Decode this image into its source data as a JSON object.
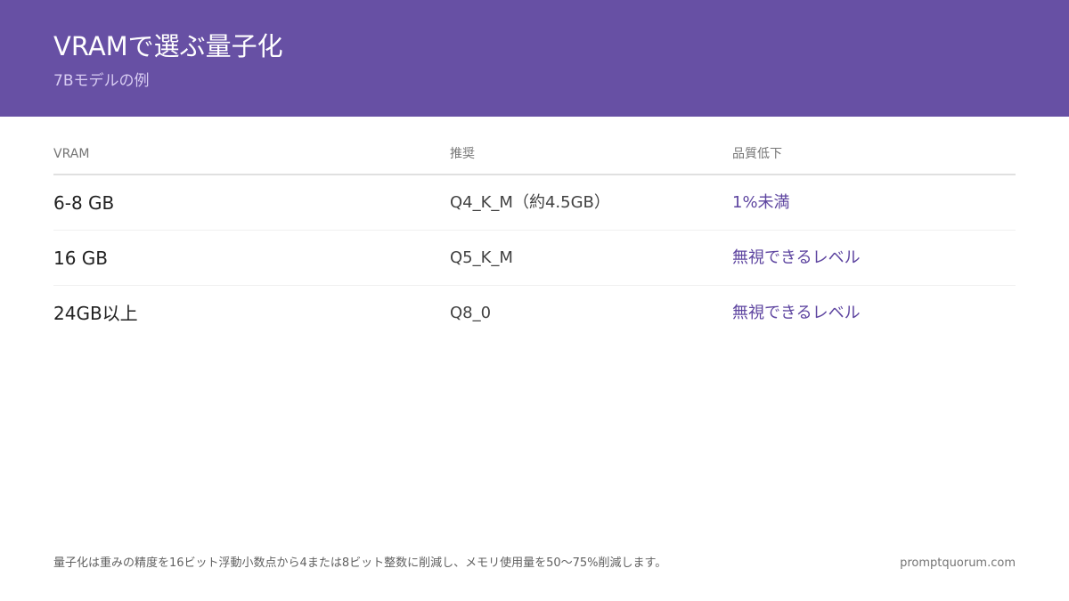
{
  "header": {
    "title": "VRAMで選ぶ量子化",
    "subtitle": "7Bモデルの例"
  },
  "table": {
    "columns": [
      "VRAM",
      "推奨",
      "品質低下"
    ],
    "rows": [
      {
        "vram": "6-8 GB",
        "recommended": "Q4_K_M（約4.5GB）",
        "quality_loss": "1%未満"
      },
      {
        "vram": "16 GB",
        "recommended": "Q5_K_M",
        "quality_loss": "無視できるレベル"
      },
      {
        "vram": "24GB以上",
        "recommended": "Q8_0",
        "quality_loss": "無視できるレベル"
      }
    ]
  },
  "footer": {
    "note": "量子化は重みの精度を16ビット浮動小数点から4または8ビット整数に削減し、メモリ使用量を50〜75%削減します。",
    "site": "promptquorum.com"
  },
  "colors": {
    "header_bg": "#6750a4",
    "accent_text": "#5e45a0"
  }
}
